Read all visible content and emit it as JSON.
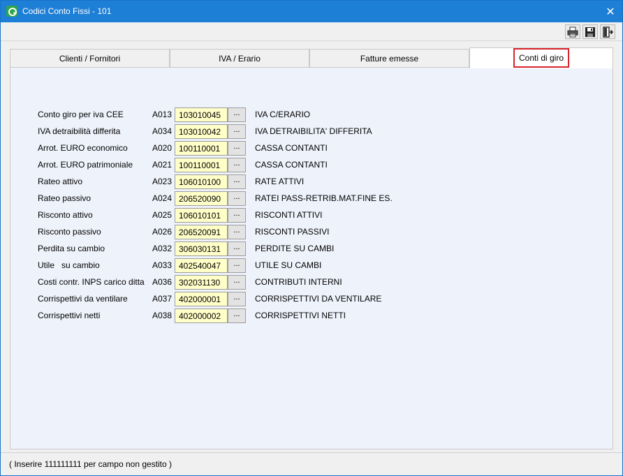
{
  "window": {
    "title": "Codici Conto Fissi - 101",
    "close_label": "✕"
  },
  "toolbar": {
    "buttons": [
      {
        "name": "print",
        "icon": "printer-icon"
      },
      {
        "name": "save",
        "icon": "floppy-disk-icon"
      },
      {
        "name": "exit",
        "icon": "exit-door-icon"
      }
    ]
  },
  "tabs": [
    {
      "label": "Clienti / Fornitori",
      "active": false
    },
    {
      "label": "IVA / Erario",
      "active": false
    },
    {
      "label": "Fatture emesse",
      "active": false
    },
    {
      "label": "Conti di giro",
      "active": true
    }
  ],
  "rows": [
    {
      "label": "Conto giro per iva CEE",
      "code": "A013",
      "value": "103010045",
      "button": "...",
      "description": "IVA C/ERARIO"
    },
    {
      "label": "IVA detraibilità differita",
      "code": "A034",
      "value": "103010042",
      "button": "...",
      "description": "IVA DETRAIBILITA' DIFFERITA"
    },
    {
      "label": "Arrot. EURO economico",
      "code": "A020",
      "value": "100110001",
      "button": "...",
      "description": "CASSA CONTANTI"
    },
    {
      "label": "Arrot. EURO patrimoniale",
      "code": "A021",
      "value": "100110001",
      "button": "...",
      "description": "CASSA CONTANTI"
    },
    {
      "label": "Rateo attivo",
      "code": "A023",
      "value": "106010100",
      "button": "...",
      "description": "RATE ATTIVI"
    },
    {
      "label": "Rateo passivo",
      "code": "A024",
      "value": "206520090",
      "button": "...",
      "description": "RATEI PASS-RETRIB.MAT.FINE ES."
    },
    {
      "label": "Risconto attivo",
      "code": "A025",
      "value": "106010101",
      "button": "...",
      "description": "RISCONTI ATTIVI"
    },
    {
      "label": "Risconto passivo",
      "code": "A026",
      "value": "206520091",
      "button": "...",
      "description": "RISCONTI PASSIVI"
    },
    {
      "label": "Perdita su cambio",
      "code": "A032",
      "value": "306030131",
      "button": "...",
      "description": "PERDITE SU CAMBI"
    },
    {
      "label": "Utile   su cambio",
      "code": "A033",
      "value": "402540047",
      "button": "...",
      "description": "UTILE SU CAMBI"
    },
    {
      "label": "Costi contr. INPS carico ditta",
      "code": "A036",
      "value": "302031130",
      "button": "...",
      "description": "CONTRIBUTI INTERNI"
    },
    {
      "label": "Corrispettivi da ventilare",
      "code": "A037",
      "value": "402000001",
      "button": "...",
      "description": "CORRISPETTIVI DA VENTILARE"
    },
    {
      "label": "Corrispettivi netti",
      "code": "A038",
      "value": "402000002",
      "button": "...",
      "description": "CORRISPETTIVI NETTI"
    }
  ],
  "status": {
    "text": "( Inserire 111111111 per campo non gestito )"
  },
  "colors": {
    "titlebar": "#1e7fd6",
    "input_bg": "#ffffc8",
    "panel_bg": "#eef2fb",
    "active_tab_outline": "#d9232d"
  }
}
